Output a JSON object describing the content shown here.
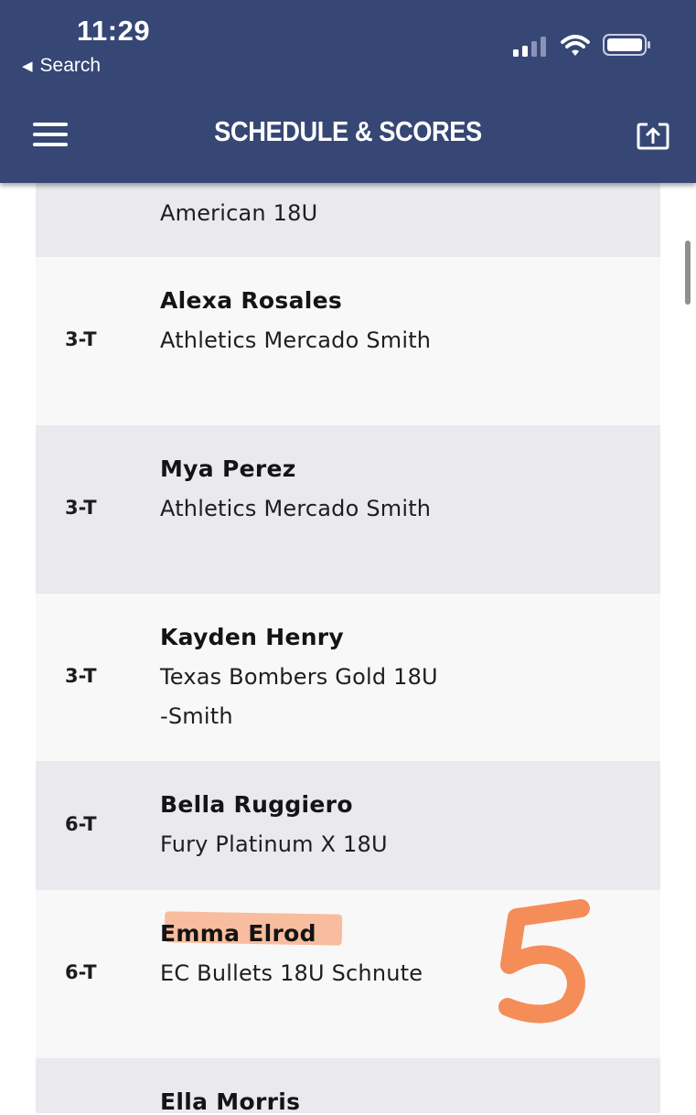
{
  "status_bar": {
    "time": "11:29",
    "back_label": "Search"
  },
  "header": {
    "title": "SCHEDULE & SCORES"
  },
  "icons": {
    "menu": "hamburger-menu-icon",
    "share": "share-icon",
    "signal": "cellular-signal-icon",
    "wifi": "wifi-icon",
    "battery": "battery-icon"
  },
  "colors": {
    "header_bg": "#364675",
    "row_shade": "#e9e9ee",
    "row_light": "#f8f8f8",
    "annotation": "#f47a3c"
  },
  "rows": [
    {
      "rank": "",
      "name": "",
      "team": "American 18U"
    },
    {
      "rank": "3-T",
      "name": "Alexa Rosales",
      "team": "Athletics Mercado Smith"
    },
    {
      "rank": "3-T",
      "name": "Mya Perez",
      "team": "Athletics Mercado Smith"
    },
    {
      "rank": "3-T",
      "name": "Kayden Henry",
      "team": "Texas Bombers Gold 18U-Smith"
    },
    {
      "rank": "6-T",
      "name": "Bella Ruggiero",
      "team": "Fury Platinum X 18U"
    },
    {
      "rank": "6-T",
      "name": "Emma Elrod",
      "team": "EC Bullets 18U Schnute"
    },
    {
      "rank": "",
      "name": "Ella Morris",
      "team": ""
    }
  ],
  "annotation": {
    "text": "5"
  }
}
